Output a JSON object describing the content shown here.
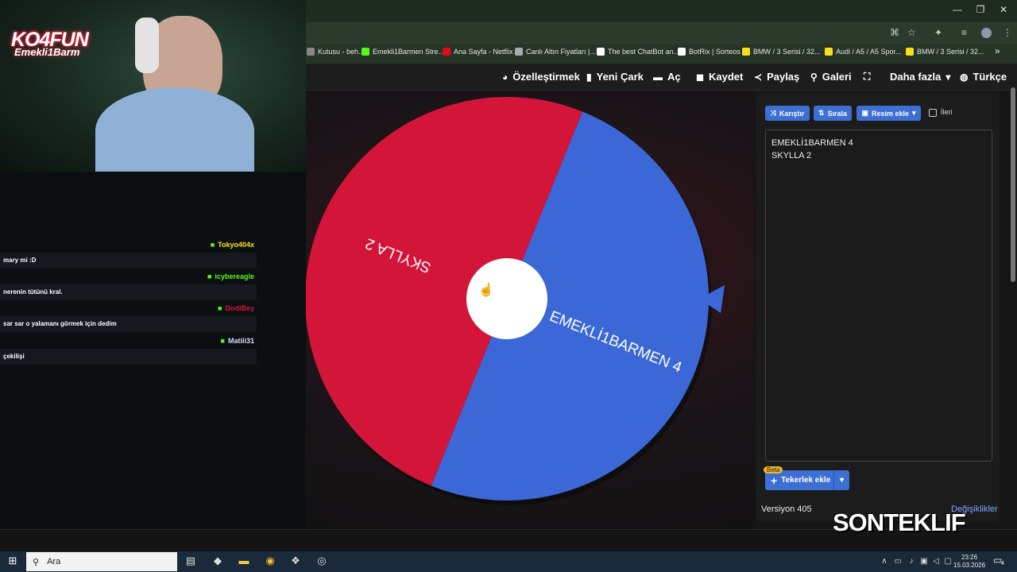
{
  "browser": {
    "window_controls": [
      "—",
      "❐",
      "✕"
    ],
    "bookmarks": [
      {
        "label": "Kutusu - beh...",
        "color": "#888888"
      },
      {
        "label": "Emekli1Barmen Stre...",
        "color": "#53fc18"
      },
      {
        "label": "Ana Sayfa - Netflix",
        "color": "#e50914"
      },
      {
        "label": "Canlı Altın Fiyatları |...",
        "color": "#aaaaaa"
      },
      {
        "label": "The best ChatBot an...",
        "color": "#ffffff"
      },
      {
        "label": "BotRix | Sorteos",
        "color": "#ffffff"
      },
      {
        "label": "BMW / 3 Serisi / 32...",
        "color": "#f5e11b"
      },
      {
        "label": "Audi / A5 / A5 Spor...",
        "color": "#f5e11b"
      },
      {
        "label": "BMW / 3 Serisi / 32...",
        "color": "#f5e11b"
      }
    ],
    "more": "»"
  },
  "toolbar": {
    "customize": "Özelleştirmek",
    "new_wheel": "Yeni Çark",
    "open": "Aç",
    "save": "Kaydet",
    "share": "Paylaş",
    "gallery": "Galeri",
    "more": "Daha fazla",
    "language": "Türkçe"
  },
  "wheel": {
    "segments": [
      {
        "label": "SKYLLA 2",
        "color": "#d4153a",
        "weight": 2
      },
      {
        "label": "EMEKLİ1BARMEN 4",
        "color": "#3b68d6",
        "weight": 4
      }
    ],
    "pointer_color": "#3b68d6"
  },
  "side": {
    "shuffle": "Karıştır",
    "sort": "Sırala",
    "add_image": "Resim ekle",
    "advanced": "İleri",
    "entries": [
      "EMEKLİ1BARMEN 4",
      "SKYLLA 2"
    ],
    "beta": "Beta",
    "add_wheel": "Tekerlek ekle",
    "version": "Versiyon 405",
    "changes": "Değişiklikler"
  },
  "stream": {
    "logo_main": "KO4FUN",
    "logo_sub": "Emekli1Barm",
    "chat": [
      {
        "user": "Tokyo404x",
        "user_color": "#f5e11b",
        "message": "mary mi :D"
      },
      {
        "user": "icybereagle",
        "user_color": "#53fc18",
        "message": "nerenin tütünü kral."
      },
      {
        "user": "DodiBey",
        "user_color": "#d4153a",
        "message": "sar sar o yalamanı görmek için dedim"
      },
      {
        "user": "Matili31",
        "user_color": "#d9d9ff",
        "message": "çekilişi"
      }
    ],
    "watermark": "SONTEKLIF"
  },
  "taskbar": {
    "search_placeholder": "Ara",
    "time": "23:26",
    "date": "15.03.2026",
    "notifications": "4"
  }
}
